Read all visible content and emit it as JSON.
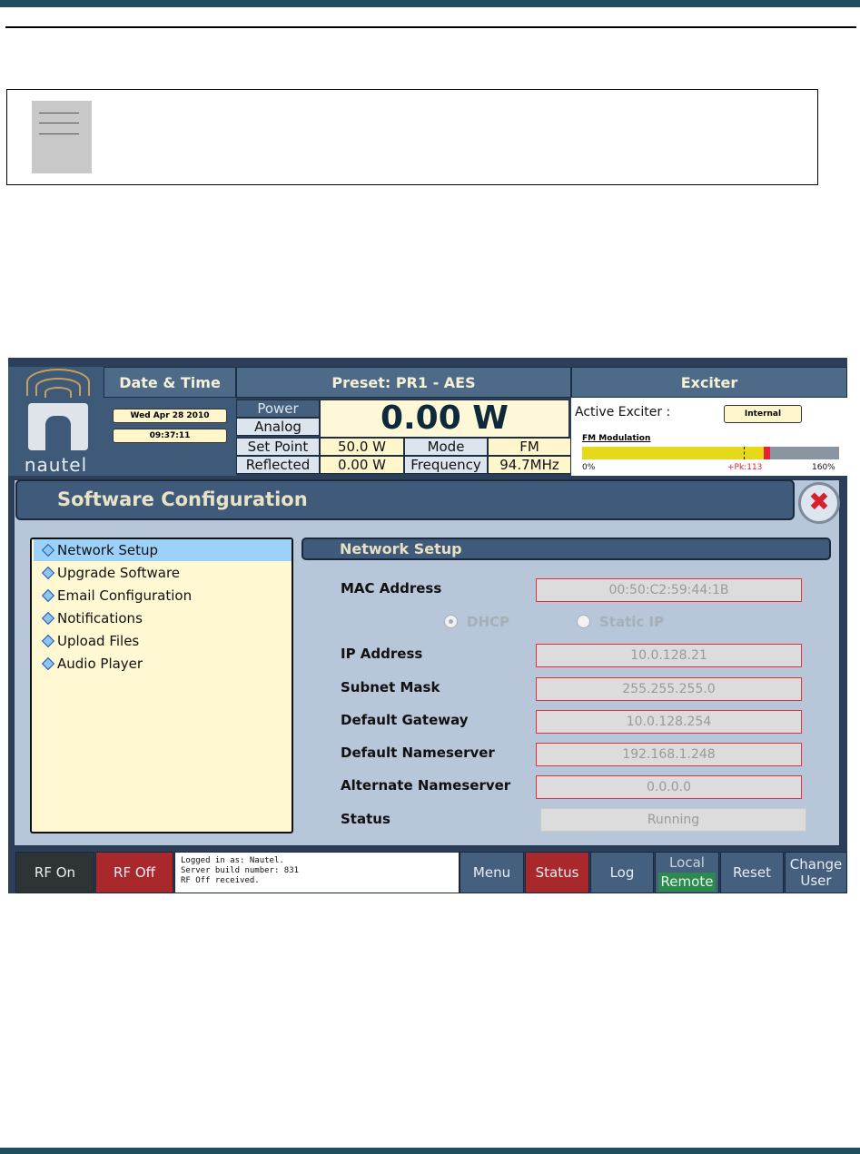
{
  "header": {
    "date_time_title": "Date & Time",
    "date": "Wed Apr 28 2010",
    "time": "09:37:11",
    "preset_title": "Preset: PR1 - AES",
    "power_label": "Power",
    "analog_label": "Analog",
    "power_value": "0.00 W",
    "setpoint_label": "Set Point",
    "setpoint_value": "50.0 W",
    "mode_label": "Mode",
    "mode_value": "FM",
    "reflected_label": "Reflected",
    "reflected_value": "0.00 W",
    "frequency_label": "Frequency",
    "frequency_value": "94.7MHz",
    "exciter_title": "Exciter",
    "active_exciter_label": "Active Exciter :",
    "active_exciter_value": "Internal",
    "fm_mod_label": "FM Modulation",
    "fm_min": "0%",
    "fm_peak": "+Pk:113",
    "fm_max": "160%",
    "fm_level_pct": 113,
    "fm_peak_pct": 113
  },
  "logo": {
    "text": "nautel"
  },
  "page": {
    "title": "Software Configuration"
  },
  "menu": {
    "items": [
      {
        "label": "Network Setup",
        "selected": true
      },
      {
        "label": "Upgrade Software"
      },
      {
        "label": "Email Configuration"
      },
      {
        "label": "Notifications"
      },
      {
        "label": "Upload Files"
      },
      {
        "label": "Audio Player"
      }
    ]
  },
  "network": {
    "title": "Network Setup",
    "mac_label": "MAC Address",
    "mac_value": "00:50:C2:59:44:1B",
    "dhcp_label": "DHCP",
    "static_label": "Static IP",
    "ip_label": "IP Address",
    "ip_value": "10.0.128.21",
    "subnet_label": "Subnet Mask",
    "subnet_value": "255.255.255.0",
    "gateway_label": "Default Gateway",
    "gateway_value": "10.0.128.254",
    "dns_label": "Default Nameserver",
    "dns_value": "192.168.1.248",
    "alt_dns_label": "Alternate Nameserver",
    "alt_dns_value": "0.0.0.0",
    "status_label": "Status",
    "status_value": "Running"
  },
  "footer": {
    "rf_on": "RF On",
    "rf_off": "RF Off",
    "log_line1": "Logged in as:    Nautel.",
    "log_line2": "Server build number: 831",
    "log_line3": "RF Off received.",
    "menu": "Menu",
    "status": "Status",
    "log": "Log",
    "local": "Local",
    "remote": "Remote",
    "reset": "Reset",
    "change_user": "Change User"
  },
  "colors": {
    "frame": "#2b3f58",
    "accent_yellow": "#fff6cc",
    "rf_off_red": "#a8282c",
    "remote_green": "#2d8a4e",
    "selected_blue": "#9cd2fa"
  }
}
